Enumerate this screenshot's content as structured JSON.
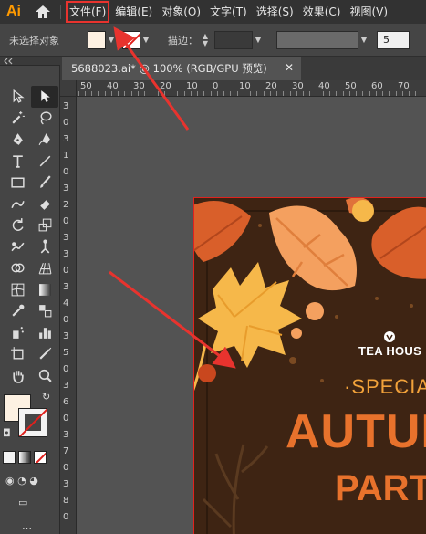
{
  "app": {
    "logo": "Ai",
    "home_icon": "home-icon"
  },
  "menu": {
    "items": [
      "文件(F)",
      "编辑(E)",
      "对象(O)",
      "文字(T)",
      "选择(S)",
      "效果(C)",
      "视图(V)"
    ],
    "highlighted_index": 0
  },
  "control_bar": {
    "selection_label": "未选择对象",
    "fill_color": "#fdf1e2",
    "stroke_label": "描边：",
    "stroke_value": "",
    "points_value": "5"
  },
  "document_tab": {
    "title": "5688023.ai* @ 100% (RGB/GPU 预览)",
    "close_icon": "close-icon"
  },
  "ruler": {
    "horizontal": [
      "50",
      "40",
      "30",
      "20",
      "10",
      "0",
      "10",
      "20",
      "30",
      "40",
      "50",
      "60",
      "70"
    ],
    "vertical": [
      "3",
      "0",
      "3",
      "1",
      "0",
      "3",
      "2",
      "0",
      "3",
      "3",
      "0",
      "3",
      "4",
      "0",
      "3",
      "5",
      "0",
      "3",
      "6",
      "0",
      "3",
      "7",
      "0",
      "3",
      "8",
      "0"
    ]
  },
  "toolbar": {
    "tools": [
      "selection-tool-icon",
      "direct-selection-tool-icon",
      "magic-wand-icon",
      "lasso-icon",
      "pen-tool-icon",
      "curvature-tool-icon",
      "type-tool-icon",
      "line-segment-icon",
      "rectangle-tool-icon",
      "paintbrush-icon",
      "shaper-tool-icon",
      "eraser-icon",
      "rotate-tool-icon",
      "scale-tool-icon",
      "warp-tool-icon",
      "puppet-warp-icon",
      "shape-builder-icon",
      "perspective-grid-icon",
      "mesh-tool-icon",
      "gradient-tool-icon",
      "eyedropper-icon",
      "blend-tool-icon",
      "symbol-sprayer-icon",
      "column-graph-icon",
      "artboard-tool-icon",
      "slice-tool-icon",
      "hand-tool-icon",
      "zoom-tool-icon"
    ],
    "active_tool_index": 1,
    "fill_color": "#fdf1e2",
    "stroke_color": "none"
  },
  "artwork": {
    "brand": "TEA HOUS",
    "special": "SPECIA",
    "headline": "AUTUM",
    "subline": "PART",
    "background_color": "#3e2413",
    "accent_orange": "#e8722c",
    "accent_yellow": "#f2a23a"
  }
}
